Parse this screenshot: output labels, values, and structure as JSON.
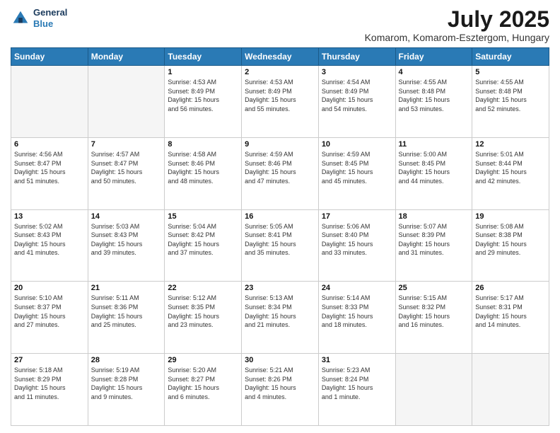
{
  "logo": {
    "line1": "General",
    "line2": "Blue"
  },
  "title": "July 2025",
  "subtitle": "Komarom, Komarom-Esztergom, Hungary",
  "days_of_week": [
    "Sunday",
    "Monday",
    "Tuesday",
    "Wednesday",
    "Thursday",
    "Friday",
    "Saturday"
  ],
  "weeks": [
    [
      {
        "num": "",
        "info": ""
      },
      {
        "num": "",
        "info": ""
      },
      {
        "num": "1",
        "info": "Sunrise: 4:53 AM\nSunset: 8:49 PM\nDaylight: 15 hours\nand 56 minutes."
      },
      {
        "num": "2",
        "info": "Sunrise: 4:53 AM\nSunset: 8:49 PM\nDaylight: 15 hours\nand 55 minutes."
      },
      {
        "num": "3",
        "info": "Sunrise: 4:54 AM\nSunset: 8:49 PM\nDaylight: 15 hours\nand 54 minutes."
      },
      {
        "num": "4",
        "info": "Sunrise: 4:55 AM\nSunset: 8:48 PM\nDaylight: 15 hours\nand 53 minutes."
      },
      {
        "num": "5",
        "info": "Sunrise: 4:55 AM\nSunset: 8:48 PM\nDaylight: 15 hours\nand 52 minutes."
      }
    ],
    [
      {
        "num": "6",
        "info": "Sunrise: 4:56 AM\nSunset: 8:47 PM\nDaylight: 15 hours\nand 51 minutes."
      },
      {
        "num": "7",
        "info": "Sunrise: 4:57 AM\nSunset: 8:47 PM\nDaylight: 15 hours\nand 50 minutes."
      },
      {
        "num": "8",
        "info": "Sunrise: 4:58 AM\nSunset: 8:46 PM\nDaylight: 15 hours\nand 48 minutes."
      },
      {
        "num": "9",
        "info": "Sunrise: 4:59 AM\nSunset: 8:46 PM\nDaylight: 15 hours\nand 47 minutes."
      },
      {
        "num": "10",
        "info": "Sunrise: 4:59 AM\nSunset: 8:45 PM\nDaylight: 15 hours\nand 45 minutes."
      },
      {
        "num": "11",
        "info": "Sunrise: 5:00 AM\nSunset: 8:45 PM\nDaylight: 15 hours\nand 44 minutes."
      },
      {
        "num": "12",
        "info": "Sunrise: 5:01 AM\nSunset: 8:44 PM\nDaylight: 15 hours\nand 42 minutes."
      }
    ],
    [
      {
        "num": "13",
        "info": "Sunrise: 5:02 AM\nSunset: 8:43 PM\nDaylight: 15 hours\nand 41 minutes."
      },
      {
        "num": "14",
        "info": "Sunrise: 5:03 AM\nSunset: 8:43 PM\nDaylight: 15 hours\nand 39 minutes."
      },
      {
        "num": "15",
        "info": "Sunrise: 5:04 AM\nSunset: 8:42 PM\nDaylight: 15 hours\nand 37 minutes."
      },
      {
        "num": "16",
        "info": "Sunrise: 5:05 AM\nSunset: 8:41 PM\nDaylight: 15 hours\nand 35 minutes."
      },
      {
        "num": "17",
        "info": "Sunrise: 5:06 AM\nSunset: 8:40 PM\nDaylight: 15 hours\nand 33 minutes."
      },
      {
        "num": "18",
        "info": "Sunrise: 5:07 AM\nSunset: 8:39 PM\nDaylight: 15 hours\nand 31 minutes."
      },
      {
        "num": "19",
        "info": "Sunrise: 5:08 AM\nSunset: 8:38 PM\nDaylight: 15 hours\nand 29 minutes."
      }
    ],
    [
      {
        "num": "20",
        "info": "Sunrise: 5:10 AM\nSunset: 8:37 PM\nDaylight: 15 hours\nand 27 minutes."
      },
      {
        "num": "21",
        "info": "Sunrise: 5:11 AM\nSunset: 8:36 PM\nDaylight: 15 hours\nand 25 minutes."
      },
      {
        "num": "22",
        "info": "Sunrise: 5:12 AM\nSunset: 8:35 PM\nDaylight: 15 hours\nand 23 minutes."
      },
      {
        "num": "23",
        "info": "Sunrise: 5:13 AM\nSunset: 8:34 PM\nDaylight: 15 hours\nand 21 minutes."
      },
      {
        "num": "24",
        "info": "Sunrise: 5:14 AM\nSunset: 8:33 PM\nDaylight: 15 hours\nand 18 minutes."
      },
      {
        "num": "25",
        "info": "Sunrise: 5:15 AM\nSunset: 8:32 PM\nDaylight: 15 hours\nand 16 minutes."
      },
      {
        "num": "26",
        "info": "Sunrise: 5:17 AM\nSunset: 8:31 PM\nDaylight: 15 hours\nand 14 minutes."
      }
    ],
    [
      {
        "num": "27",
        "info": "Sunrise: 5:18 AM\nSunset: 8:29 PM\nDaylight: 15 hours\nand 11 minutes."
      },
      {
        "num": "28",
        "info": "Sunrise: 5:19 AM\nSunset: 8:28 PM\nDaylight: 15 hours\nand 9 minutes."
      },
      {
        "num": "29",
        "info": "Sunrise: 5:20 AM\nSunset: 8:27 PM\nDaylight: 15 hours\nand 6 minutes."
      },
      {
        "num": "30",
        "info": "Sunrise: 5:21 AM\nSunset: 8:26 PM\nDaylight: 15 hours\nand 4 minutes."
      },
      {
        "num": "31",
        "info": "Sunrise: 5:23 AM\nSunset: 8:24 PM\nDaylight: 15 hours\nand 1 minute."
      },
      {
        "num": "",
        "info": ""
      },
      {
        "num": "",
        "info": ""
      }
    ]
  ]
}
